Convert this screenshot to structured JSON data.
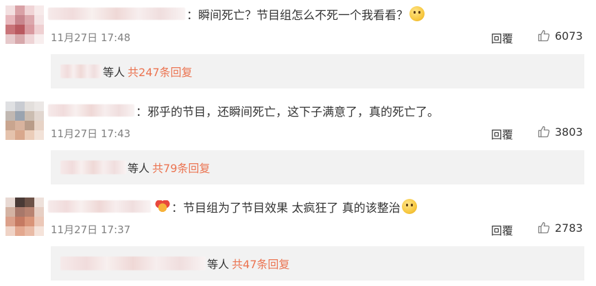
{
  "comments": [
    {
      "text": "：瞬间死亡？节目组怎么不死一个我看看？",
      "time": "11月27日 17:48",
      "reply_label": "回覆",
      "likes": "6073",
      "sub_reply_prefix": "等人",
      "sub_reply_total": "共247条回复",
      "emoji": "surprised-face-emoji"
    },
    {
      "text": "：邪乎的节目，还瞬间死亡，这下子满意了，真的死亡了。",
      "time": "11月27日 17:43",
      "reply_label": "回覆",
      "likes": "3803",
      "sub_reply_prefix": "等人",
      "sub_reply_total": "共79条回复"
    },
    {
      "text": "：节目组为了节目效果 太疯狂了 真的该整治",
      "time": "11月27日 17:37",
      "reply_label": "回覆",
      "likes": "2783",
      "sub_reply_prefix": "等人",
      "sub_reply_total": "共47条回复",
      "emoji": "thinking-face-emoji"
    }
  ],
  "colors": {
    "accent": "#eb7350",
    "meta": "#808080",
    "reply_bg": "#f2f2f2"
  }
}
